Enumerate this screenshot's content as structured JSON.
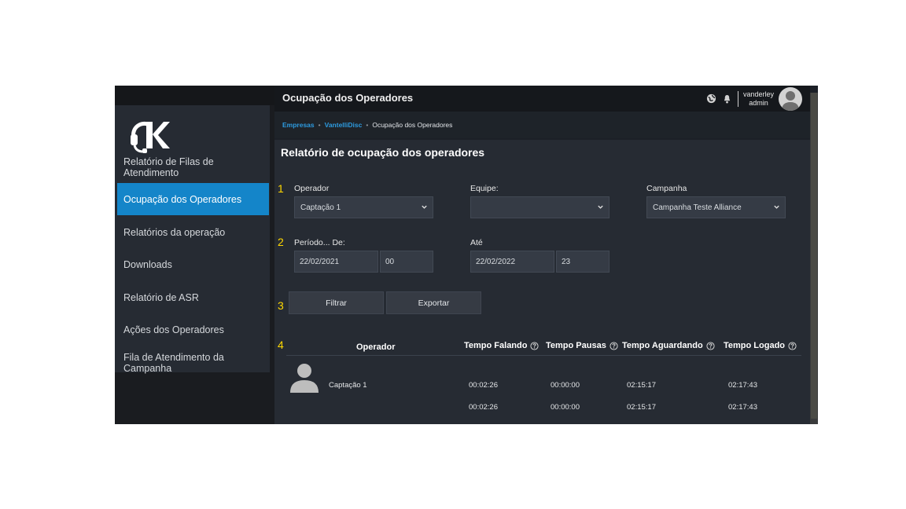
{
  "window": {
    "title": "Ocupação dos Operadores"
  },
  "user": {
    "name": "vanderley",
    "role": "admin"
  },
  "icons": {
    "globe": "globe-icon",
    "bell": "bell-icon",
    "logo": "headset-k-logo-icon",
    "help": "help-circle-icon",
    "chevron": "chevron-down-icon",
    "avatar": "user-avatar-icon"
  },
  "colors": {
    "accent": "#1485c9",
    "link": "#2d9be0",
    "step_number": "#ffd800"
  },
  "sidebar": {
    "items": [
      {
        "label": "Relatório de Filas de Atendimento",
        "active": false
      },
      {
        "label": "Ocupação dos Operadores",
        "active": true
      },
      {
        "label": "Relatórios da operação",
        "active": false
      },
      {
        "label": "Downloads",
        "active": false
      },
      {
        "label": "Relatório de ASR",
        "active": false
      },
      {
        "label": "Ações dos Operadores",
        "active": false
      },
      {
        "label": "Fila de Atendimento da Campanha",
        "active": false
      }
    ]
  },
  "breadcrumb": {
    "items": [
      "Empresas",
      "VantelliDisc"
    ],
    "current": "Ocupação dos Operadores"
  },
  "report": {
    "title": "Relatório de ocupação dos operadores",
    "steps": [
      "1",
      "2",
      "3",
      "4"
    ],
    "filters": {
      "operador": {
        "label": "Operador",
        "value": "Captação 1"
      },
      "equipe": {
        "label": "Equipe:",
        "value": ""
      },
      "campanha": {
        "label": "Campanha",
        "value": "Campanha Teste Alliance"
      },
      "periodo": {
        "label": "Período... De:",
        "date": "22/02/2021",
        "hour": "00"
      },
      "ate": {
        "label": "Até",
        "date": "22/02/2022",
        "hour": "23"
      }
    },
    "buttons": {
      "filtrar": "Filtrar",
      "exportar": "Exportar"
    },
    "table": {
      "columns": [
        "Operador",
        "Tempo Falando",
        "Tempo Pausas",
        "Tempo Aguardando",
        "Tempo Logado"
      ],
      "rows": [
        {
          "operador": "Captação 1",
          "falando": "00:02:26",
          "pausas": "00:00:00",
          "aguardando": "02:15:17",
          "logado": "02:17:43"
        }
      ],
      "totals": {
        "falando": "00:02:26",
        "pausas": "00:00:00",
        "aguardando": "02:15:17",
        "logado": "02:17:43"
      }
    }
  }
}
